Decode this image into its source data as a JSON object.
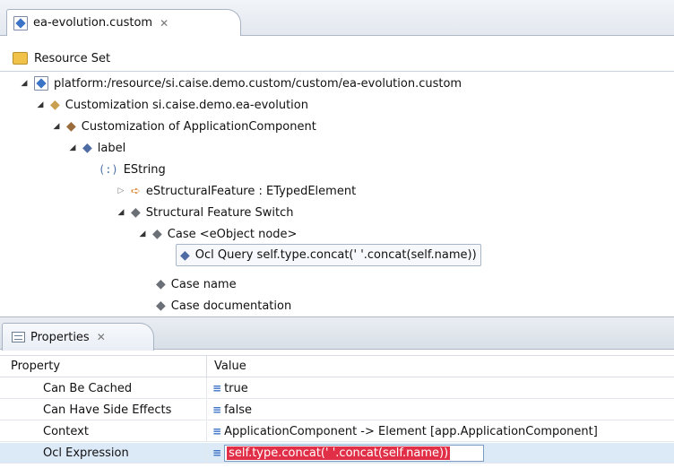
{
  "editor": {
    "tab_title": "ea-evolution.custom",
    "tab_close": "✕"
  },
  "resource_set": {
    "label": "Resource Set"
  },
  "tree": {
    "nodes": [
      {
        "label": "platform:/resource/si.caise.demo.custom/custom/ea-evolution.custom",
        "twisty": "◢",
        "icon": "file-icon"
      },
      {
        "label": "Customization si.caise.demo.ea-evolution",
        "twisty": "◢",
        "icon": "diamond-tan-icon",
        "glyph": "◆"
      },
      {
        "label": "Customization of ApplicationComponent",
        "twisty": "◢",
        "icon": "diamond-brown-icon",
        "glyph": "◆"
      },
      {
        "label": "label",
        "twisty": "◢",
        "icon": "diamond-blue-icon",
        "glyph": "◆"
      },
      {
        "label": "EString",
        "icon": "datatype-icon",
        "glyph": "(:)"
      },
      {
        "label": "eStructuralFeature : ETypedElement",
        "twisty": "▷",
        "icon": "link-icon",
        "glyph": "➪"
      },
      {
        "label": "Structural Feature Switch",
        "twisty": "◢",
        "icon": "diamond-gray-icon",
        "glyph": "◆"
      },
      {
        "label": "Case <eObject node>",
        "twisty": "◢",
        "icon": "diamond-gray-icon",
        "glyph": "◆"
      },
      {
        "label": "Ocl Query self.type.concat(' '.concat(self.name))",
        "icon": "diamond-blue-icon",
        "glyph": "◆"
      },
      {
        "label": "Case name",
        "icon": "diamond-gray-icon",
        "glyph": "◆"
      },
      {
        "label": "Case documentation",
        "icon": "diamond-gray-icon",
        "glyph": "◆"
      }
    ]
  },
  "properties": {
    "tab_title": "Properties",
    "tab_close": "✕",
    "columns": {
      "property": "Property",
      "value": "Value"
    },
    "value_icon": "≡",
    "rows": [
      {
        "property": "Can Be Cached",
        "value": "true"
      },
      {
        "property": "Can Have Side Effects",
        "value": "false"
      },
      {
        "property": "Context",
        "value": "ApplicationComponent -> Element [app.ApplicationComponent]"
      },
      {
        "property": "Ocl Expression",
        "value": "self.type.concat(' '.concat(self.name))"
      }
    ]
  },
  "colors": {
    "selection_highlight": "#e02f46",
    "row_selected": "#dce9f7"
  }
}
